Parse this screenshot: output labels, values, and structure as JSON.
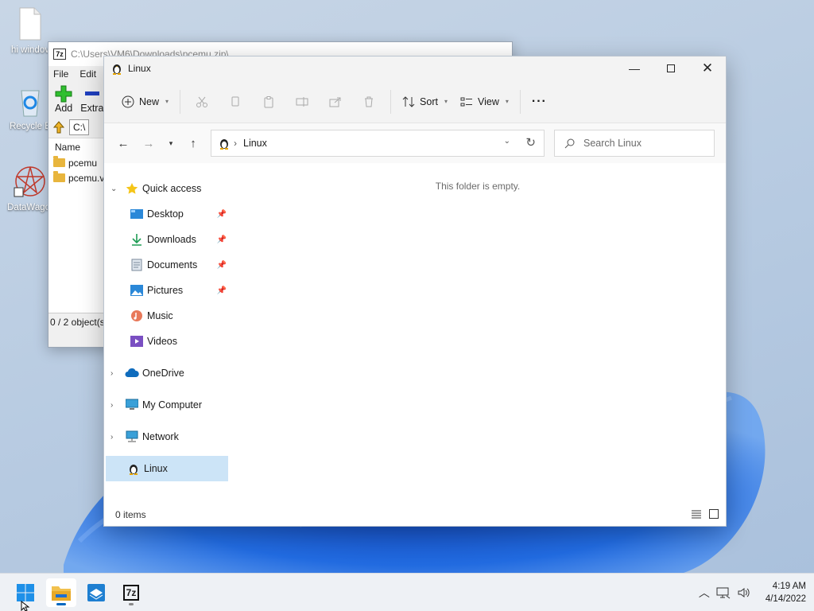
{
  "desktop": {
    "icons": [
      {
        "label": "hi windov"
      },
      {
        "label": "Recycle B"
      },
      {
        "label": "DataWagor"
      }
    ]
  },
  "zip_window": {
    "title": "C:\\Users\\VM6\\Downloads\\pcemu.zip\\",
    "logo": "7z",
    "menu": [
      "File",
      "Edit"
    ],
    "toolbar": {
      "add": "Add",
      "extract": "Extra"
    },
    "address": "C:\\",
    "column": "Name",
    "items": [
      "pcemu",
      "pcemu.v"
    ],
    "status": "0 / 2 object(s"
  },
  "explorer": {
    "title": "Linux",
    "commands": {
      "new": "New",
      "sort": "Sort",
      "view": "View",
      "more": "···"
    },
    "address": {
      "path": "Linux"
    },
    "search": {
      "placeholder": "Search Linux"
    },
    "nav": {
      "quick_access": "Quick access",
      "desktop": "Desktop",
      "downloads": "Downloads",
      "documents": "Documents",
      "pictures": "Pictures",
      "music": "Music",
      "videos": "Videos",
      "onedrive": "OneDrive",
      "my_computer": "My Computer",
      "network": "Network",
      "linux": "Linux"
    },
    "empty_message": "This folder is empty.",
    "status": "0 items"
  },
  "taskbar": {
    "clock": {
      "time": "4:19 AM",
      "date": "4/14/2022"
    },
    "zip_label": "7z"
  },
  "colors": {
    "accent": "#0067c0",
    "selected": "#cce4f7",
    "folder": "#e8b53d"
  }
}
